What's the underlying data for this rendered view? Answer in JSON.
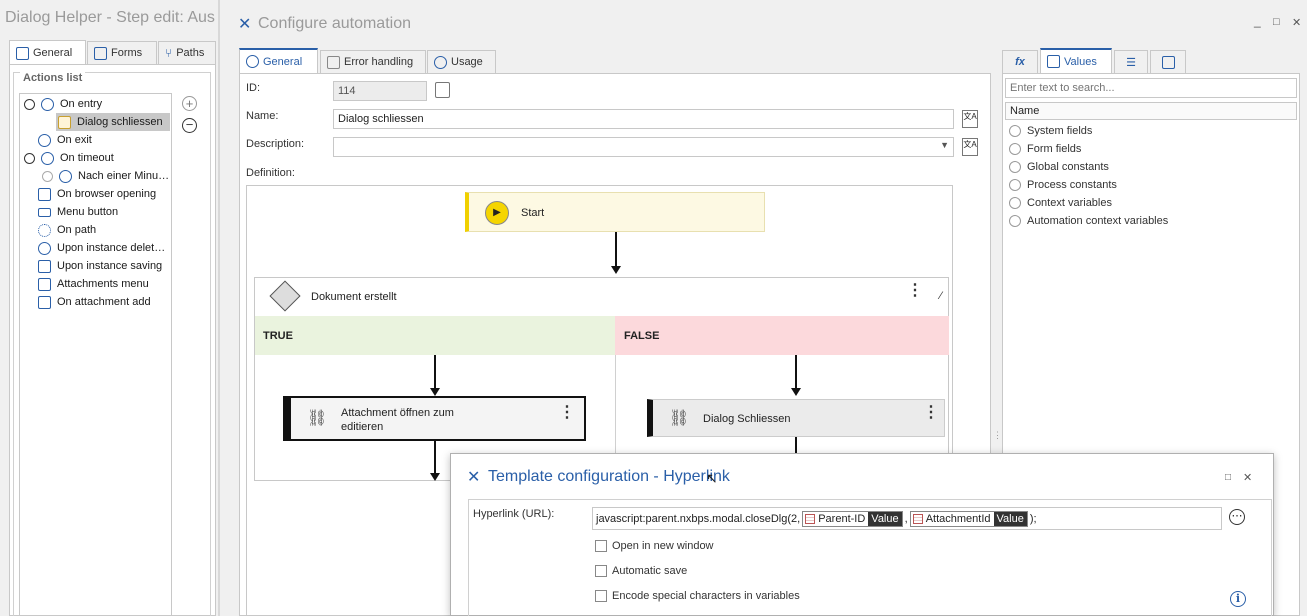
{
  "left": {
    "title": "Dialog Helper - Step edit: Aus",
    "tabs": [
      "General",
      "Forms",
      "Paths"
    ],
    "actions_header": "Actions list",
    "items": [
      {
        "label": "On entry",
        "icon": "arrow-right-circle-icon"
      },
      {
        "label": "Dialog schliessen",
        "icon": "action-icon"
      },
      {
        "label": "On exit",
        "icon": "exit-icon"
      },
      {
        "label": "On timeout",
        "icon": "clock-icon"
      },
      {
        "label": "Nach einer Minu…",
        "icon": "clock-icon"
      },
      {
        "label": "On browser opening",
        "icon": "browser-icon"
      },
      {
        "label": "Menu button",
        "icon": "menu-button-icon"
      },
      {
        "label": "On path",
        "icon": "path-icon"
      },
      {
        "label": "Upon instance delet…",
        "icon": "delete-circle-icon"
      },
      {
        "label": "Upon instance saving",
        "icon": "save-icon"
      },
      {
        "label": "Attachments menu",
        "icon": "attachment-icon"
      },
      {
        "label": "On attachment add",
        "icon": "attachment-add-icon"
      }
    ],
    "add_symbol": "+",
    "remove_symbol": "−"
  },
  "config": {
    "title": "Configure automation",
    "tabs": [
      "General",
      "Error handling",
      "Usage"
    ],
    "id_label": "ID:",
    "id_value": "114",
    "name_label": "Name:",
    "name_value": "Dialog schliessen",
    "description_label": "Description:",
    "description_value": "",
    "definition_label": "Definition:",
    "start_label": "Start",
    "condition_label": "Dokument erstellt",
    "true_label": "TRUE",
    "false_label": "FALSE",
    "true_action": "Attachment öffnen zum editieren",
    "false_action": "Dialog Schliessen",
    "window_controls": {
      "minimize": "_",
      "maximize": "□",
      "close": "✕"
    }
  },
  "right": {
    "tab_fx": "fx",
    "tab_values": "Values",
    "search_placeholder": "Enter text to search...",
    "column_header": "Name",
    "items": [
      "System fields",
      "Form fields",
      "Global constants",
      "Process constants",
      "Context variables",
      "Automation context variables"
    ]
  },
  "template": {
    "title": "Template configuration - Hyperlink",
    "hyperlink_label": "Hyperlink (URL):",
    "url_prefix": "javascript:parent.nxbps.modal.closeDlg(2,",
    "token1_name": "Parent-ID",
    "token2_name": "AttachmentId",
    "token_value": "Value",
    "separator": ",",
    "url_suffix": ");",
    "open_new_window": "Open in new window",
    "automatic_save": "Automatic save",
    "encode_special": "Encode special characters in variables",
    "checkboxes": {
      "open_new_window": false,
      "automatic_save": false,
      "encode_special": false
    },
    "info_symbol": "i",
    "more_symbol": "⋯"
  },
  "colors": {
    "accent": "#2a5fa8",
    "start_bg": "#fdf9e3",
    "start_bar": "#f0d000",
    "true_bg": "#eaf3de",
    "false_bg": "#fcd9dc"
  }
}
